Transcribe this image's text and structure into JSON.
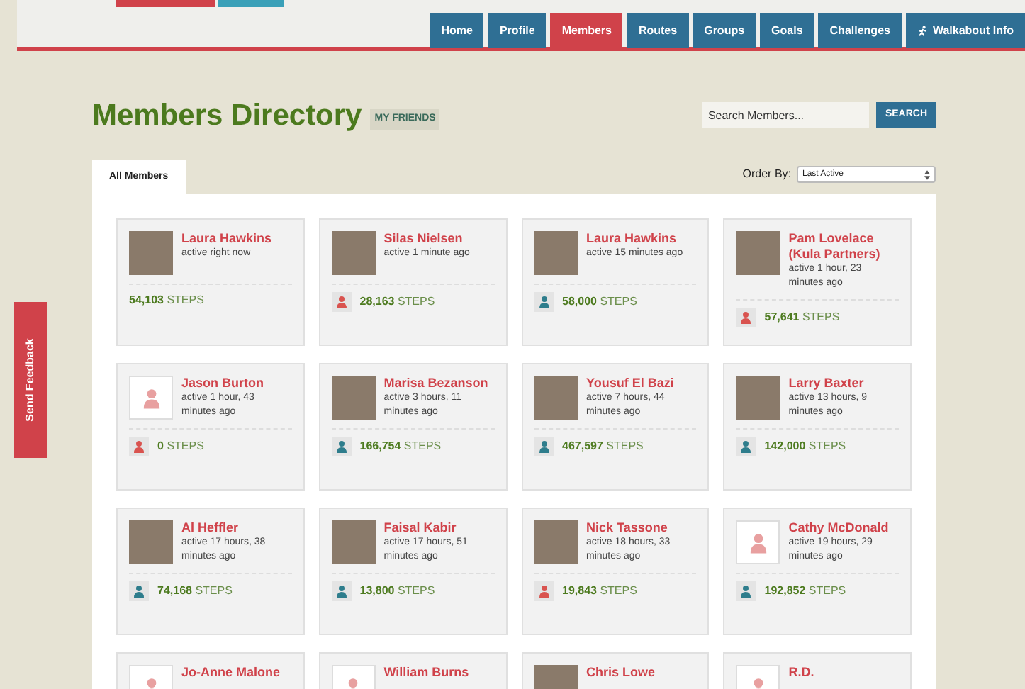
{
  "nav": {
    "items": [
      {
        "label": "Home",
        "selected": false,
        "icon": false
      },
      {
        "label": "Profile",
        "selected": false,
        "icon": false
      },
      {
        "label": "Members",
        "selected": true,
        "icon": false
      },
      {
        "label": "Routes",
        "selected": false,
        "icon": false
      },
      {
        "label": "Groups",
        "selected": false,
        "icon": false
      },
      {
        "label": "Goals",
        "selected": false,
        "icon": false
      },
      {
        "label": "Challenges",
        "selected": false,
        "icon": false
      },
      {
        "label": "Walkabout Info",
        "selected": false,
        "icon": true
      }
    ]
  },
  "feedback": "Send Feedback",
  "title": "Members Directory",
  "filter_badge": "MY FRIENDS",
  "search": {
    "placeholder": "Search Members...",
    "button": "SEARCH"
  },
  "tabs": [
    {
      "label": "All Members",
      "selected": true
    }
  ],
  "order_by": {
    "label": "Order By:",
    "value": "Last Active"
  },
  "members": [
    {
      "name": "Laura Hawkins",
      "activity": "active right now",
      "steps": "54,103",
      "unit": "STEPS",
      "photo": true
    },
    {
      "name": "Silas Nielsen",
      "activity": "active 1 minute ago",
      "steps": "28,163",
      "unit": "STEPS",
      "photo": true,
      "color": "#d9534f"
    },
    {
      "name": "Laura Hawkins",
      "activity": "active 15 minutes ago",
      "steps": "58,000",
      "unit": "STEPS",
      "photo": true,
      "color": "#2e7d8c"
    },
    {
      "name": "Pam Lovelace (Kula Partners)",
      "activity": "active 1 hour, 23 minutes ago",
      "steps": "57,641",
      "unit": "STEPS",
      "photo": true,
      "color": "#d9534f"
    },
    {
      "name": "Jason Burton",
      "activity": "active 1 hour, 43 minutes ago",
      "steps": "0",
      "unit": "STEPS",
      "photo": false,
      "color": "#d9534f"
    },
    {
      "name": "Marisa Bezanson",
      "activity": "active 3 hours, 11 minutes ago",
      "steps": "166,754",
      "unit": "STEPS",
      "photo": true,
      "color": "#2e7d8c"
    },
    {
      "name": "Yousuf El Bazi",
      "activity": "active 7 hours, 44 minutes ago",
      "steps": "467,597",
      "unit": "STEPS",
      "photo": true,
      "color": "#2e7d8c"
    },
    {
      "name": "Larry Baxter",
      "activity": "active 13 hours, 9 minutes ago",
      "steps": "142,000",
      "unit": "STEPS",
      "photo": true,
      "color": "#2e7d8c"
    },
    {
      "name": "Al Heffler",
      "activity": "active 17 hours, 38 minutes ago",
      "steps": "74,168",
      "unit": "STEPS",
      "photo": true,
      "color": "#2e7d8c"
    },
    {
      "name": "Faisal Kabir",
      "activity": "active 17 hours, 51 minutes ago",
      "steps": "13,800",
      "unit": "STEPS",
      "photo": true,
      "color": "#2e7d8c"
    },
    {
      "name": "Nick Tassone",
      "activity": "active 18 hours, 33 minutes ago",
      "steps": "19,843",
      "unit": "STEPS",
      "photo": true,
      "color": "#d9534f"
    },
    {
      "name": "Cathy McDonald",
      "activity": "active 19 hours, 29 minutes ago",
      "steps": "192,852",
      "unit": "STEPS",
      "photo": false,
      "color": "#2e7d8c"
    },
    {
      "name": "Jo-Anne Malone",
      "photo": false
    },
    {
      "name": "William Burns",
      "photo": false
    },
    {
      "name": "Chris Lowe",
      "photo": true
    },
    {
      "name": "R.D.",
      "photo": false
    }
  ]
}
